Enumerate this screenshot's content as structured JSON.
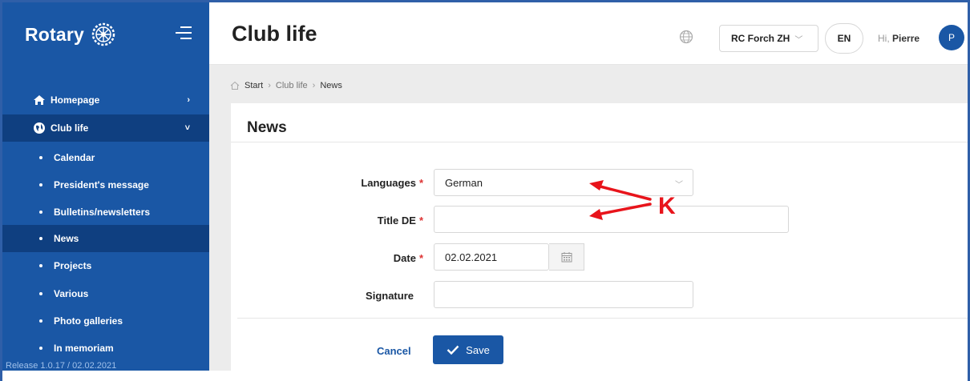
{
  "sidebar": {
    "brand": "Rotary",
    "nav": [
      {
        "label": "Homepage",
        "chevron": "›"
      },
      {
        "label": "Club life",
        "chevron": "˅"
      }
    ],
    "sub_items": [
      "Calendar",
      "President's message",
      "Bulletins/newsletters",
      "News",
      "Projects",
      "Various",
      "Photo galleries",
      "In memoriam"
    ],
    "active_sub": "News",
    "release": "Release 1.0.17 / 02.02.2021"
  },
  "header": {
    "title": "Club life",
    "club": "RC Forch ZH",
    "language": "EN",
    "greeting": "Hi,",
    "user": "Pierre",
    "avatar_initial": "P"
  },
  "breadcrumb": [
    "Start",
    "Club life",
    "News"
  ],
  "card": {
    "title": "News",
    "fields": {
      "languages": {
        "label": "Languages",
        "value": "German"
      },
      "title_de": {
        "label": "Title DE",
        "value": ""
      },
      "date": {
        "label": "Date",
        "value": "02.02.2021"
      },
      "signature": {
        "label": "Signature",
        "value": ""
      }
    },
    "required_mark": "*",
    "cancel": "Cancel",
    "save": "Save"
  },
  "annotation": {
    "letter": "K",
    "color": "#e8141b"
  },
  "colors": {
    "sidebar": "#1a57a5",
    "sidebar_active": "#0f3f80",
    "accent": "#1a57a5"
  }
}
